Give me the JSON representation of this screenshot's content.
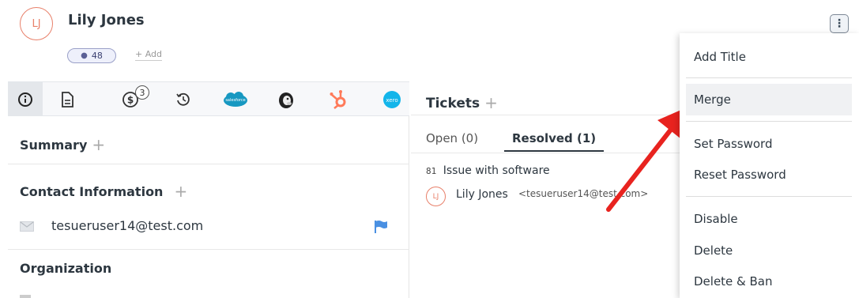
{
  "contact": {
    "initials": "LJ",
    "name": "Lily Jones",
    "count": "48",
    "add_label": "+ Add"
  },
  "colors": {
    "avatar_accent": "#e8806a",
    "flag": "#4a90e2",
    "arrow": "#e8231f",
    "hubspot": "#ff7a59",
    "salesforce": "#1798c1",
    "xero": "#13b5ea"
  },
  "tabs": [
    {
      "icon": "info-icon",
      "active": true
    },
    {
      "icon": "document-icon"
    },
    {
      "icon": "billing-icon",
      "badge": "3"
    },
    {
      "icon": "history-icon"
    },
    {
      "icon": "salesforce-icon",
      "text": "salesforce"
    },
    {
      "icon": "mailchimp-icon"
    },
    {
      "icon": "hubspot-icon"
    },
    {
      "icon": "xero-icon",
      "text": "xero"
    }
  ],
  "sections": {
    "summary": "Summary",
    "contact_information": "Contact Information",
    "organization": "Organization",
    "plus": "+"
  },
  "email": "tesueruser14@test.com",
  "tickets": {
    "title": "Tickets",
    "tab_open": "Open (0)",
    "tab_resolved": "Resolved (1)",
    "item": {
      "id": "81",
      "subject": "Issue with software",
      "requester_initials": "LJ",
      "requester_name": "Lily Jones",
      "requester_email": "<tesueruser14@test.com>"
    }
  },
  "menu": {
    "items": [
      "Add Title",
      "Merge",
      "Set Password",
      "Reset Password",
      "Disable",
      "Delete",
      "Delete & Ban"
    ],
    "hovered": "Merge"
  }
}
